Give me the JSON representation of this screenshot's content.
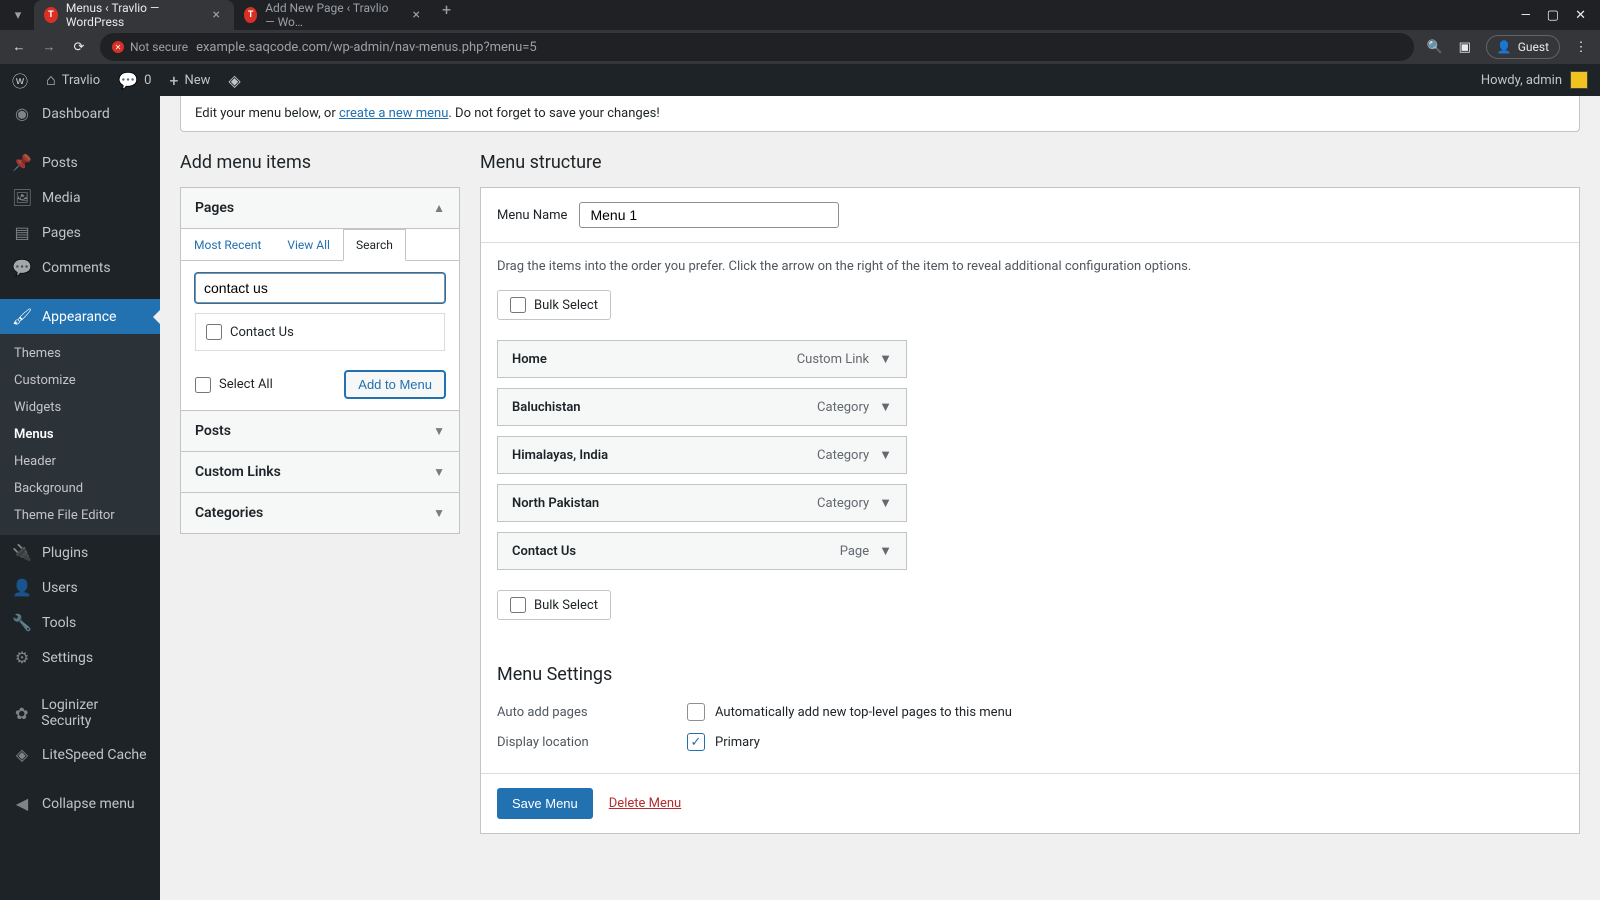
{
  "browser": {
    "tabs": [
      {
        "title": "Menus ‹ Travlio — WordPress"
      },
      {
        "title": "Add New Page ‹ Travlio — Wo…"
      }
    ],
    "not_secure": "Not secure",
    "url": "example.saqcode.com/wp-admin/nav-menus.php?menu=5",
    "guest": "Guest"
  },
  "adminbar": {
    "site": "Travlio",
    "comments": "0",
    "new": "New",
    "howdy": "Howdy, admin"
  },
  "sidebar": {
    "items": [
      {
        "icon": "dash",
        "label": "Dashboard"
      },
      {
        "icon": "pin",
        "label": "Posts"
      },
      {
        "icon": "media",
        "label": "Media"
      },
      {
        "icon": "page",
        "label": "Pages"
      },
      {
        "icon": "comment",
        "label": "Comments"
      },
      {
        "icon": "brush",
        "label": "Appearance"
      },
      {
        "icon": "plug",
        "label": "Plugins"
      },
      {
        "icon": "user",
        "label": "Users"
      },
      {
        "icon": "wrench",
        "label": "Tools"
      },
      {
        "icon": "gear",
        "label": "Settings"
      },
      {
        "icon": "shield",
        "label": "Loginizer Security"
      },
      {
        "icon": "bolt",
        "label": "LiteSpeed Cache"
      },
      {
        "icon": "collapse",
        "label": "Collapse menu"
      }
    ],
    "submenu": [
      "Themes",
      "Customize",
      "Widgets",
      "Menus",
      "Header",
      "Background",
      "Theme File Editor"
    ]
  },
  "notice": {
    "pre": "Edit your menu below, or ",
    "link": "create a new menu",
    "post": ". Do not forget to save your changes!"
  },
  "left": {
    "heading": "Add menu items",
    "pages": {
      "title": "Pages",
      "tabs": [
        "Most Recent",
        "View All",
        "Search"
      ],
      "search_value": "contact us",
      "result": "Contact Us",
      "select_all": "Select All",
      "add": "Add to Menu"
    },
    "posts": "Posts",
    "custom": "Custom Links",
    "categories": "Categories"
  },
  "right": {
    "heading": "Menu structure",
    "name_label": "Menu Name",
    "name_value": "Menu 1",
    "instructions": "Drag the items into the order you prefer. Click the arrow on the right of the item to reveal additional configuration options.",
    "bulk": "Bulk Select",
    "items": [
      {
        "title": "Home",
        "type": "Custom Link"
      },
      {
        "title": "Baluchistan",
        "type": "Category"
      },
      {
        "title": "Himalayas, India",
        "type": "Category"
      },
      {
        "title": "North Pakistan",
        "type": "Category"
      },
      {
        "title": "Contact Us",
        "type": "Page"
      }
    ],
    "settings": {
      "heading": "Menu Settings",
      "auto_label": "Auto add pages",
      "auto_text": "Automatically add new top-level pages to this menu",
      "loc_label": "Display location",
      "loc_text": "Primary"
    },
    "save": "Save Menu",
    "delete": "Delete Menu"
  }
}
